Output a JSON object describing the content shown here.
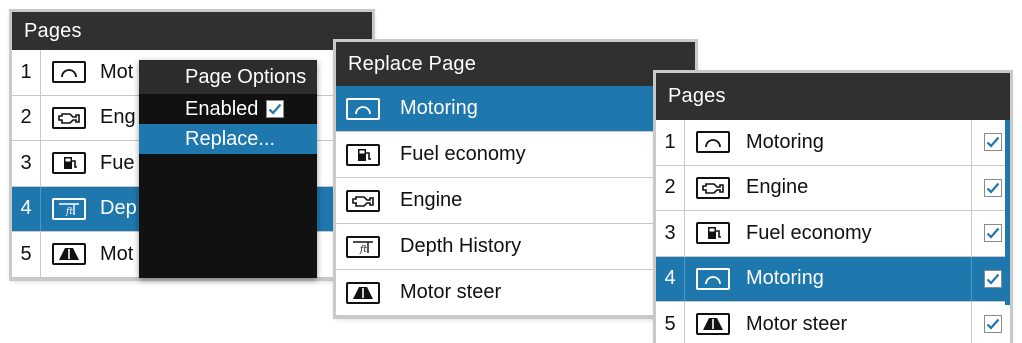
{
  "colors": {
    "accent": "#1e77ad",
    "titlebar": "#303030",
    "checkmark": "#1e77ad"
  },
  "pages_left": {
    "title": "Pages",
    "rows": [
      {
        "num": "1",
        "icon": "motoring-icon",
        "label": "Mot",
        "selected": false
      },
      {
        "num": "2",
        "icon": "engine-icon",
        "label": "Eng",
        "selected": false
      },
      {
        "num": "3",
        "icon": "fuel-icon",
        "label": "Fue",
        "selected": false
      },
      {
        "num": "4",
        "icon": "depth-icon",
        "label": "Dep",
        "selected": true
      },
      {
        "num": "5",
        "icon": "motor-steer-icon",
        "label": "Mot",
        "selected": false
      }
    ]
  },
  "page_options": {
    "title": "Page Options",
    "enabled_label": "Enabled",
    "enabled_checked": true,
    "replace_label": "Replace..."
  },
  "replace_page": {
    "title": "Replace Page",
    "items": [
      {
        "icon": "motoring-icon",
        "label": "Motoring",
        "selected": true
      },
      {
        "icon": "fuel-icon",
        "label": "Fuel economy",
        "selected": false
      },
      {
        "icon": "engine-icon",
        "label": "Engine",
        "selected": false
      },
      {
        "icon": "depth-icon",
        "label": "Depth History",
        "selected": false
      },
      {
        "icon": "motor-steer-icon",
        "label": "Motor steer",
        "selected": false
      }
    ]
  },
  "pages_right": {
    "title": "Pages",
    "rows": [
      {
        "num": "1",
        "icon": "motoring-icon",
        "label": "Motoring",
        "checked": true,
        "selected": false
      },
      {
        "num": "2",
        "icon": "engine-icon",
        "label": "Engine",
        "checked": true,
        "selected": false
      },
      {
        "num": "3",
        "icon": "fuel-icon",
        "label": "Fuel economy",
        "checked": true,
        "selected": false
      },
      {
        "num": "4",
        "icon": "motoring-icon",
        "label": "Motoring",
        "checked": true,
        "selected": true
      },
      {
        "num": "5",
        "icon": "motor-steer-icon",
        "label": "Motor steer",
        "checked": true,
        "selected": false
      }
    ]
  }
}
